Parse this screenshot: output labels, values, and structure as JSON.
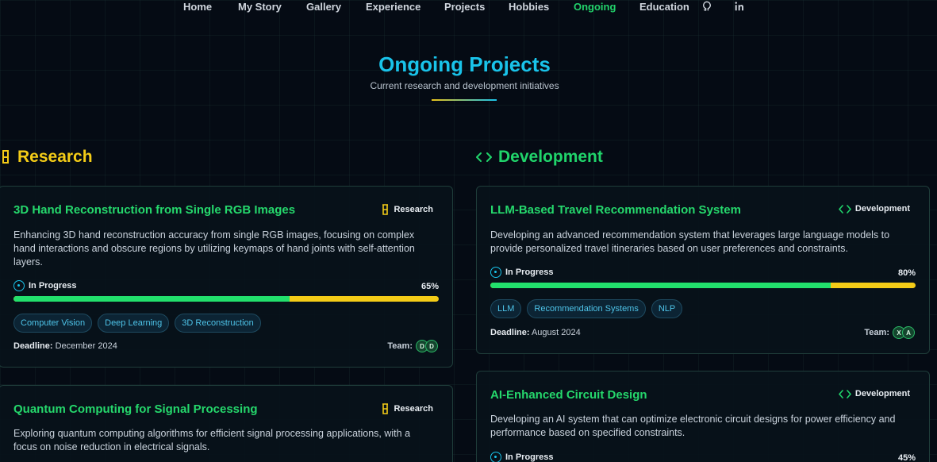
{
  "nav": {
    "items": [
      "Home",
      "My Story",
      "Gallery",
      "Experience",
      "Projects",
      "Hobbies",
      "Ongoing",
      "Education"
    ],
    "active": "Ongoing",
    "icons": [
      "github-icon",
      "linkedin-icon"
    ]
  },
  "header": {
    "title": "Ongoing Projects",
    "subtitle": "Current research and development initiatives"
  },
  "sections": {
    "research": {
      "heading": "Research",
      "cards": [
        {
          "title": "3D Hand Reconstruction from Single RGB Images",
          "type": "Research",
          "description": "Enhancing 3D hand reconstruction accuracy from single RGB images, focusing on complex hand interactions and obscure regions by utilizing keymaps of hand joints with self-attention layers.",
          "status": "In Progress",
          "progress": "65%",
          "tags": [
            "Computer Vision",
            "Deep Learning",
            "3D Reconstruction"
          ],
          "deadline_label": "Deadline:",
          "deadline": "December 2024",
          "team_label": "Team:",
          "team": [
            "D",
            "D"
          ]
        },
        {
          "title": "Quantum Computing for Signal Processing",
          "type": "Research",
          "description": "Exploring quantum computing algorithms for efficient signal processing applications, with a focus on noise reduction in electrical signals."
        }
      ]
    },
    "development": {
      "heading": "Development",
      "cards": [
        {
          "title": "LLM-Based Travel Recommendation System",
          "type": "Development",
          "description": "Developing an advanced recommendation system that leverages large language models to provide personalized travel itineraries based on user preferences and constraints.",
          "status": "In Progress",
          "progress": "80%",
          "tags": [
            "LLM",
            "Recommendation Systems",
            "NLP"
          ],
          "deadline_label": "Deadline:",
          "deadline": "August 2024",
          "team_label": "Team:",
          "team": [
            "X",
            "A"
          ]
        },
        {
          "title": "AI-Enhanced Circuit Design",
          "type": "Development",
          "description": "Developing an AI system that can optimize electronic circuit designs for power efficiency and performance based on specified constraints.",
          "status": "In Progress",
          "progress": "45%"
        }
      ]
    }
  },
  "colors": {
    "accent_cyan": "#19c3ea",
    "accent_green": "#22d36b",
    "accent_yellow": "#f4cc17",
    "background": "#050b14"
  }
}
